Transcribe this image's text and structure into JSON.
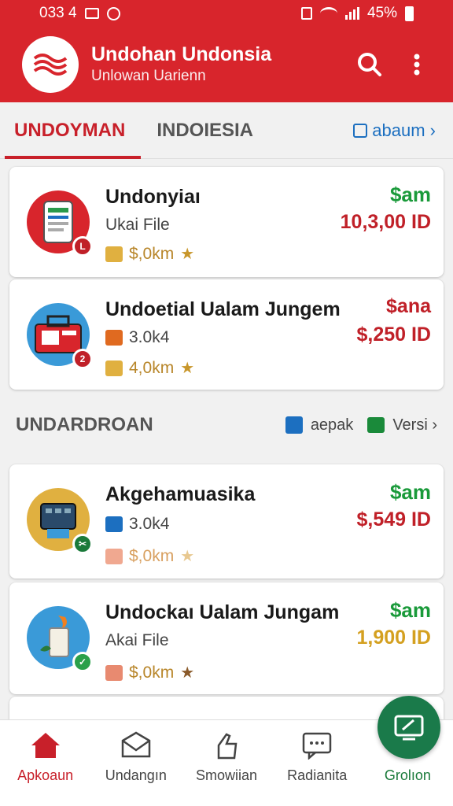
{
  "status_bar": {
    "time": "033 4",
    "battery": "45%"
  },
  "app_bar": {
    "title": "Undohan Undonsia",
    "subtitle": "Unlowan Uarienn"
  },
  "tabs": [
    {
      "label": "UNDOYMAN",
      "active": true
    },
    {
      "label": "INDOIESIA",
      "active": false
    }
  ],
  "tab_link": {
    "label": "abaum ›"
  },
  "cards_top": [
    {
      "title": "Undonyiaı",
      "subtitle": "Ukai File",
      "rating": "$,0km",
      "price_top": "$am",
      "price": "10,3,00 ID"
    },
    {
      "title": "Undoetial Ualam Jungem",
      "subtitle": "3.0k4",
      "rating": "4,0km",
      "price_top": "$ana",
      "price": "$,250 ID"
    }
  ],
  "section": {
    "title": "UNDARDROAN",
    "action1": "aepak",
    "action2": "Versi ›"
  },
  "cards_bottom": [
    {
      "title": "Akgehamuasika",
      "subtitle": "3.0k4",
      "rating": "$,0km",
      "price_top": "$am",
      "price": "$,549 ID"
    },
    {
      "title": "Undockaı Ualam Jungam",
      "subtitle": "Akai File",
      "rating": "$,0km",
      "price_top": "$am",
      "price": "1,900 ID"
    }
  ],
  "bottom_nav": [
    {
      "label": "Apkoaun",
      "icon": "home-icon"
    },
    {
      "label": "Undangın",
      "icon": "envelope-icon"
    },
    {
      "label": "Smowiian",
      "icon": "hand-icon"
    },
    {
      "label": "Radianita",
      "icon": "chat-icon"
    },
    {
      "label": "Grolıon",
      "icon": "fab-icon"
    }
  ],
  "colors": {
    "primary": "#d8252c",
    "green": "#1a9a3a",
    "price_red": "#c02028",
    "gold": "#d4a020"
  }
}
